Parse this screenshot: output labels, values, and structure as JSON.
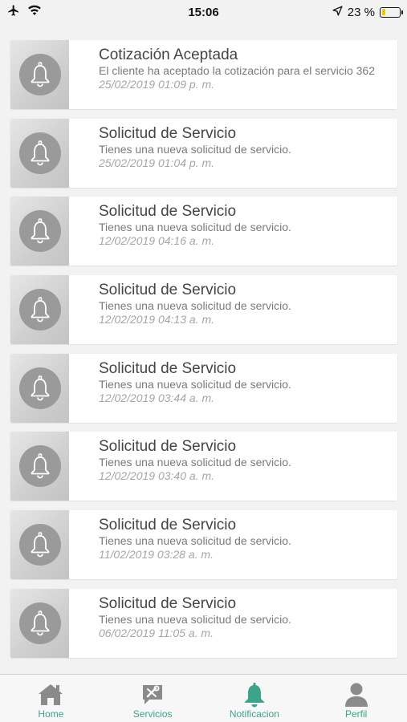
{
  "status_bar": {
    "time": "15:06",
    "battery": "23 %",
    "battery_level": 0.23
  },
  "notifications": [
    {
      "title": "Cotización Aceptada",
      "message": "El cliente ha aceptado la cotización para el servicio 362",
      "date": "25/02/2019 01:09 p. m."
    },
    {
      "title": "Solicitud de Servicio",
      "message": "Tienes una nueva solicitud de servicio.",
      "date": "25/02/2019 01:04 p. m."
    },
    {
      "title": "Solicitud de Servicio",
      "message": "Tienes una nueva solicitud de servicio.",
      "date": "12/02/2019 04:16 a. m."
    },
    {
      "title": "Solicitud de Servicio",
      "message": "Tienes una nueva solicitud de servicio.",
      "date": "12/02/2019 04:13 a. m."
    },
    {
      "title": "Solicitud de Servicio",
      "message": "Tienes una nueva solicitud de servicio.",
      "date": "12/02/2019 03:44 a. m."
    },
    {
      "title": "Solicitud de Servicio",
      "message": "Tienes una nueva solicitud de servicio.",
      "date": "12/02/2019 03:40 a. m."
    },
    {
      "title": "Solicitud de Servicio",
      "message": "Tienes una nueva solicitud de servicio.",
      "date": "11/02/2019 03:28 a. m."
    },
    {
      "title": "Solicitud de Servicio",
      "message": "Tienes una nueva solicitud de servicio.",
      "date": "06/02/2019 11:05 a. m."
    }
  ],
  "tabbar": {
    "home": "Home",
    "servicios": "Servicios",
    "notificacion": "Notificacion",
    "perfil": "Perfil"
  },
  "colors": {
    "accent": "#3aa58a",
    "icon_inactive": "#8a8a8a",
    "bell_circle": "#9a9a9a"
  }
}
